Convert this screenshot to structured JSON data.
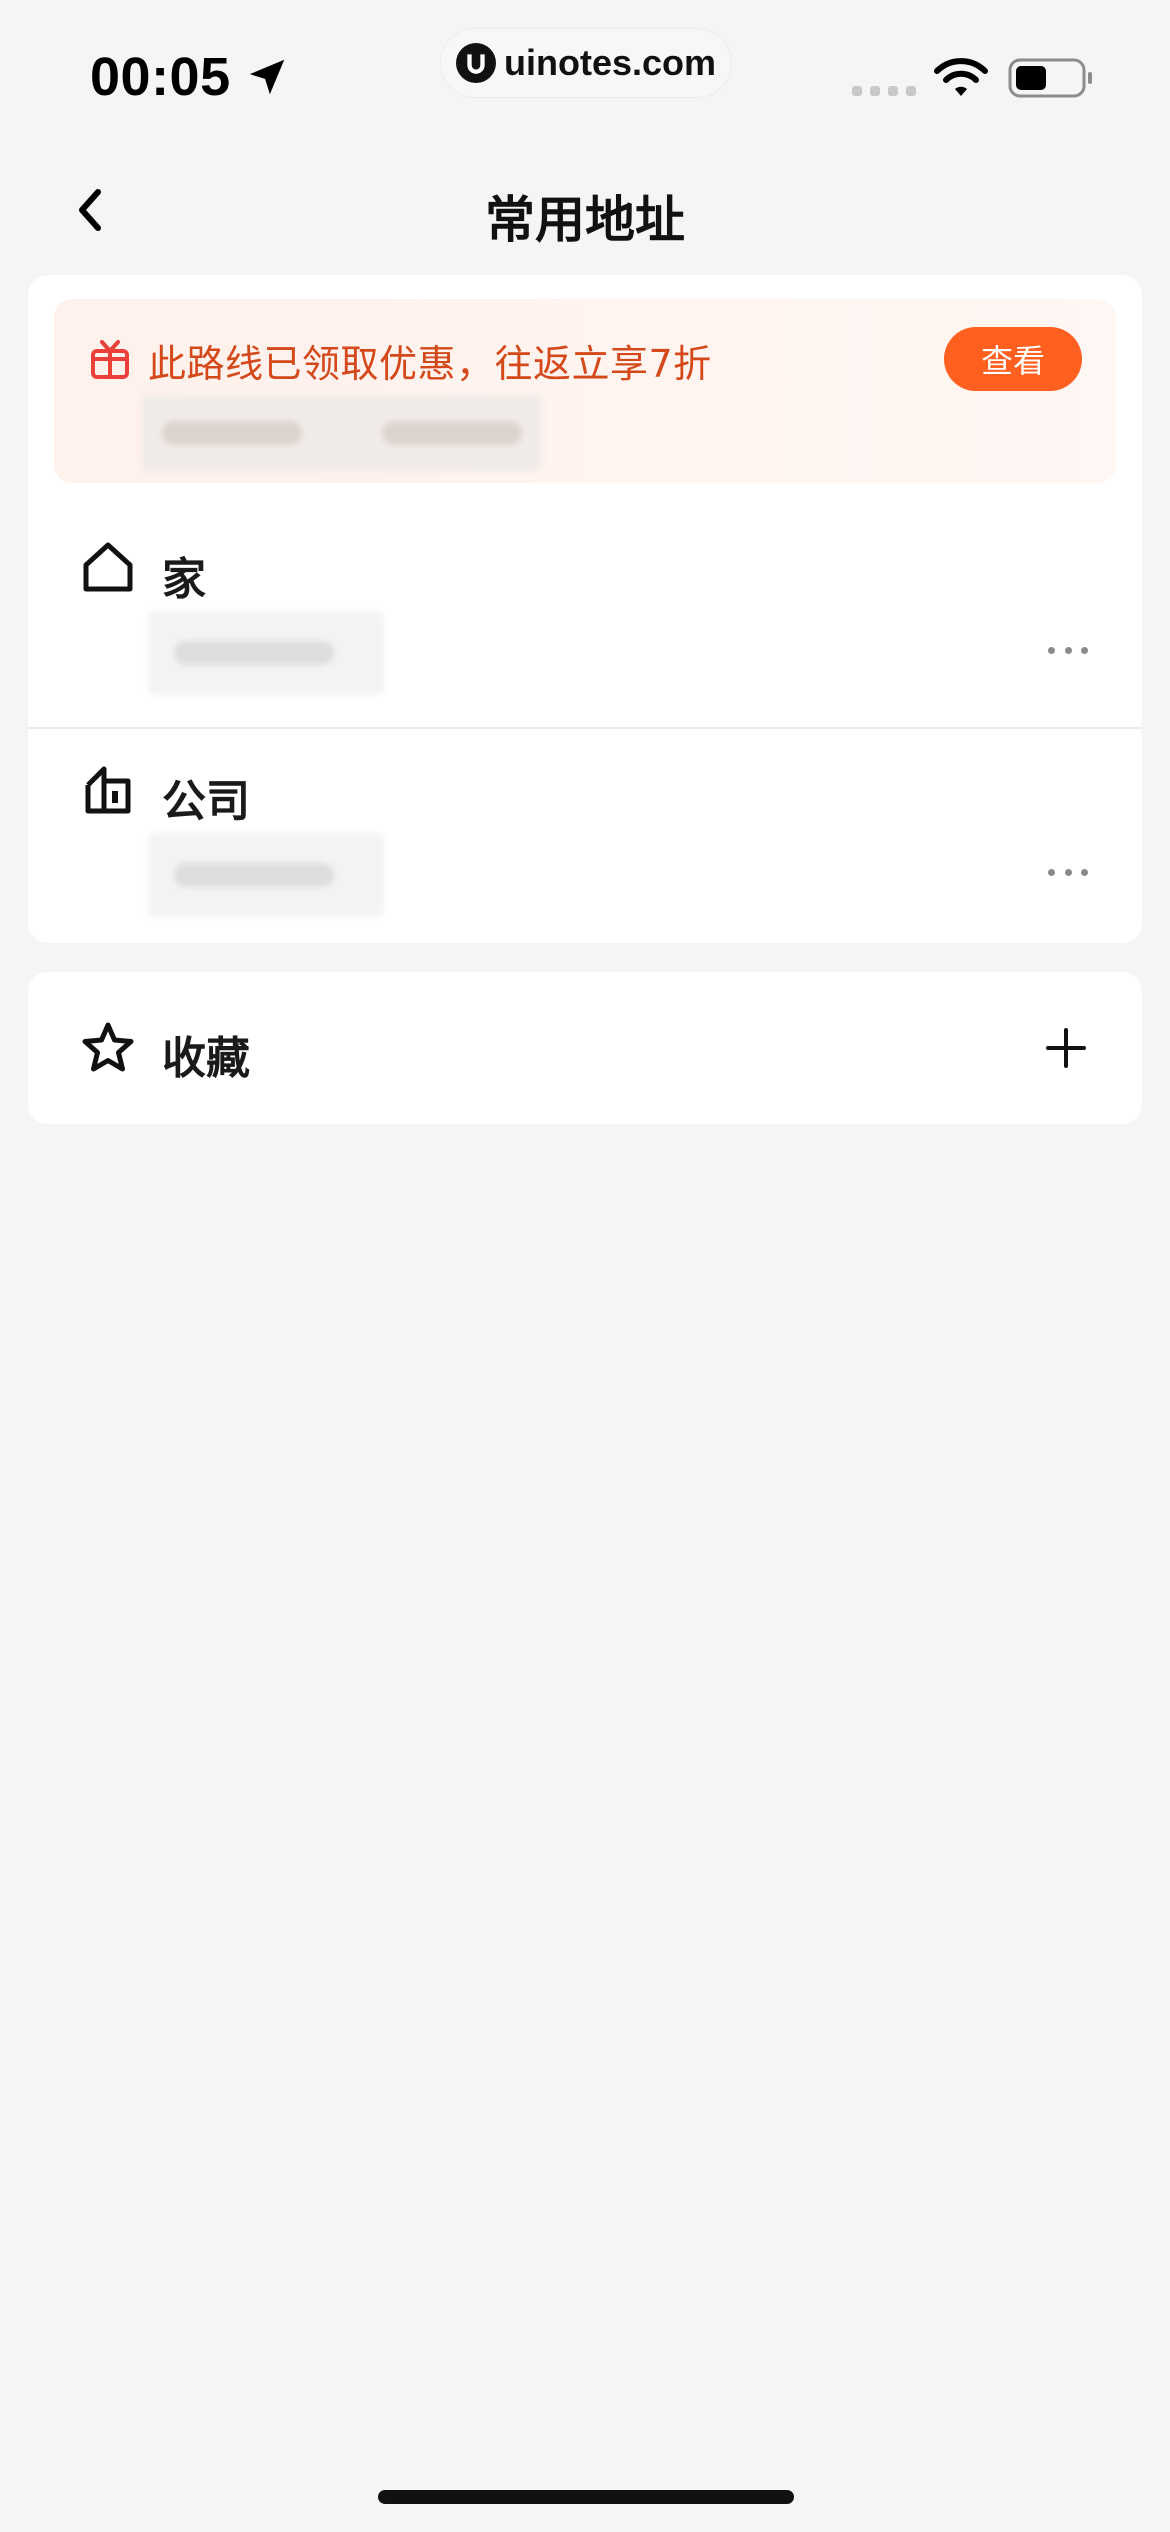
{
  "status_bar": {
    "time": "00:05",
    "watermark": "uinotes.com"
  },
  "nav": {
    "title": "常用地址"
  },
  "promo": {
    "text": "此路线已领取优惠，往返立享7折",
    "button_label": "查看",
    "accent_color": "#ff5f1f",
    "text_color": "#d4481a"
  },
  "addresses": [
    {
      "label": "家",
      "icon": "home-icon"
    },
    {
      "label": "公司",
      "icon": "company-icon"
    }
  ],
  "favorites": {
    "label": "收藏",
    "icon": "star-icon",
    "add_icon": "plus-icon"
  }
}
